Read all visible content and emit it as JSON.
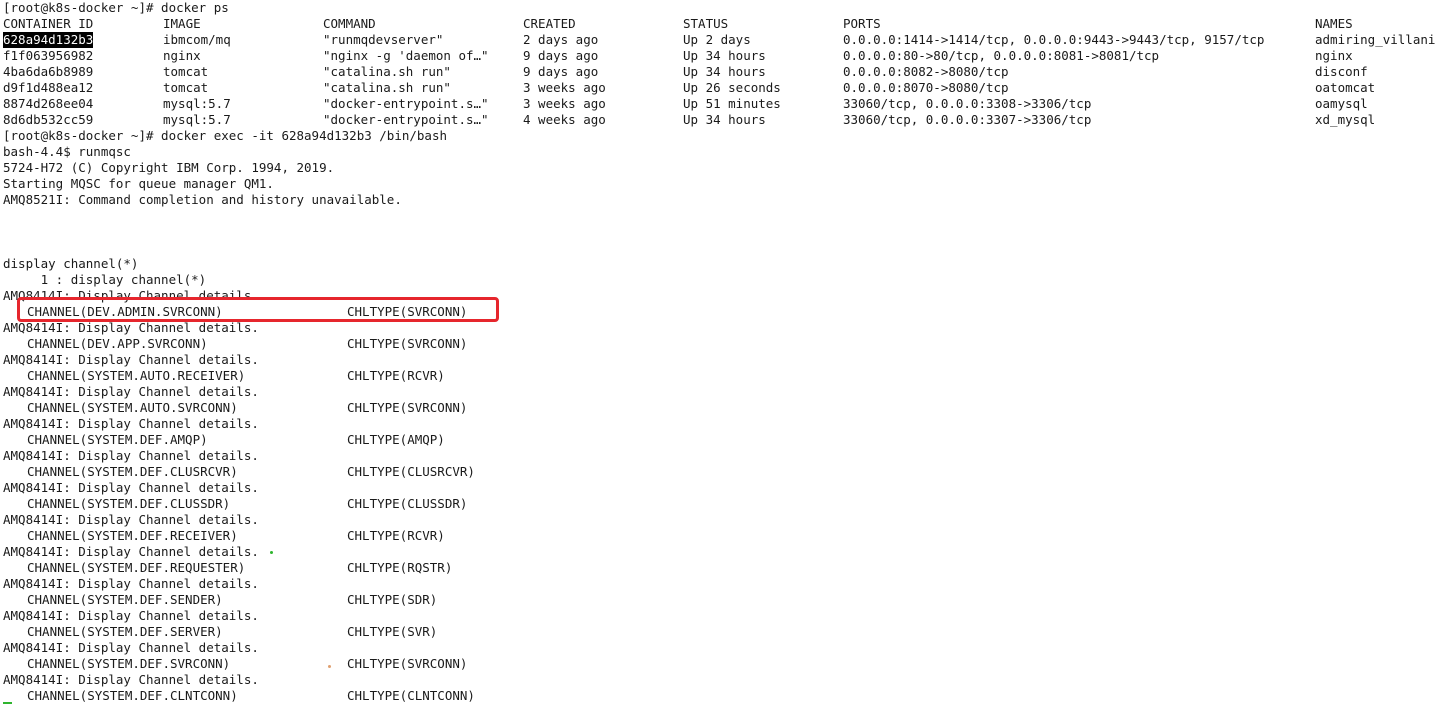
{
  "terminal": {
    "accent_colors": {
      "highlight_box": "#e6262d",
      "selection_bg": "#000000",
      "cursor": "#2fb52f"
    },
    "cmd_ps": "[root@k8s-docker ~]# docker ps",
    "ps_headers": [
      "CONTAINER ID",
      "IMAGE",
      "COMMAND",
      "CREATED",
      "STATUS",
      "PORTS",
      "NAMES"
    ],
    "ps_rows": [
      [
        "628a94d132b3",
        "ibmcom/mq",
        "\"runmqdevserver\"",
        "2 days ago",
        "Up 2 days",
        "0.0.0.0:1414->1414/tcp, 0.0.0.0:9443->9443/tcp, 9157/tcp",
        "admiring_villani"
      ],
      [
        "f1f063956982",
        "nginx",
        "\"nginx -g 'daemon of…\"",
        "9 days ago",
        "Up 34 hours",
        "0.0.0.0:80->80/tcp, 0.0.0.0:8081->8081/tcp",
        "nginx"
      ],
      [
        "4ba6da6b8989",
        "tomcat",
        "\"catalina.sh run\"",
        "9 days ago",
        "Up 34 hours",
        "0.0.0.0:8082->8080/tcp",
        "disconf"
      ],
      [
        "d9f1d488ea12",
        "tomcat",
        "\"catalina.sh run\"",
        "3 weeks ago",
        "Up 26 seconds",
        "0.0.0.0:8070->8080/tcp",
        "oatomcat"
      ],
      [
        "8874d268ee04",
        "mysql:5.7",
        "\"docker-entrypoint.s…\"",
        "3 weeks ago",
        "Up 51 minutes",
        "33060/tcp, 0.0.0.0:3308->3306/tcp",
        "oamysql"
      ],
      [
        "8d6db532cc59",
        "mysql:5.7",
        "\"docker-entrypoint.s…\"",
        "4 weeks ago",
        "Up 34 hours",
        "33060/tcp, 0.0.0.0:3307->3306/tcp",
        "xd_mysql"
      ]
    ],
    "cmd_exec": "[root@k8s-docker ~]# docker exec -it 628a94d132b3 /bin/bash",
    "cmd_runmqsc": "bash-4.4$ runmqsc",
    "copyright": "5724-H72 (C) Copyright IBM Corp. 1994, 2019.",
    "starting": "Starting MQSC for queue manager QM1.",
    "amq8521": "AMQ8521I: Command completion and history unavailable.",
    "display_cmd": "display channel(*)",
    "display_echo": "     1 : display channel(*)",
    "details_msg": "AMQ8414I: Display Channel details.",
    "channels": [
      {
        "channel": "CHANNEL(DEV.ADMIN.SVRCONN)",
        "chltype": "CHLTYPE(SVRCONN)"
      },
      {
        "channel": "CHANNEL(DEV.APP.SVRCONN)",
        "chltype": "CHLTYPE(SVRCONN)"
      },
      {
        "channel": "CHANNEL(SYSTEM.AUTO.RECEIVER)",
        "chltype": "CHLTYPE(RCVR)"
      },
      {
        "channel": "CHANNEL(SYSTEM.AUTO.SVRCONN)",
        "chltype": "CHLTYPE(SVRCONN)"
      },
      {
        "channel": "CHANNEL(SYSTEM.DEF.AMQP)",
        "chltype": "CHLTYPE(AMQP)"
      },
      {
        "channel": "CHANNEL(SYSTEM.DEF.CLUSRCVR)",
        "chltype": "CHLTYPE(CLUSRCVR)"
      },
      {
        "channel": "CHANNEL(SYSTEM.DEF.CLUSSDR)",
        "chltype": "CHLTYPE(CLUSSDR)"
      },
      {
        "channel": "CHANNEL(SYSTEM.DEF.RECEIVER)",
        "chltype": "CHLTYPE(RCVR)"
      },
      {
        "channel": "CHANNEL(SYSTEM.DEF.REQUESTER)",
        "chltype": "CHLTYPE(RQSTR)"
      },
      {
        "channel": "CHANNEL(SYSTEM.DEF.SENDER)",
        "chltype": "CHLTYPE(SDR)"
      },
      {
        "channel": "CHANNEL(SYSTEM.DEF.SERVER)",
        "chltype": "CHLTYPE(SVR)"
      },
      {
        "channel": "CHANNEL(SYSTEM.DEF.SVRCONN)",
        "chltype": "CHLTYPE(SVRCONN)"
      },
      {
        "channel": "CHANNEL(SYSTEM.DEF.CLNTCONN)",
        "chltype": "CHLTYPE(CLNTCONN)"
      }
    ]
  }
}
